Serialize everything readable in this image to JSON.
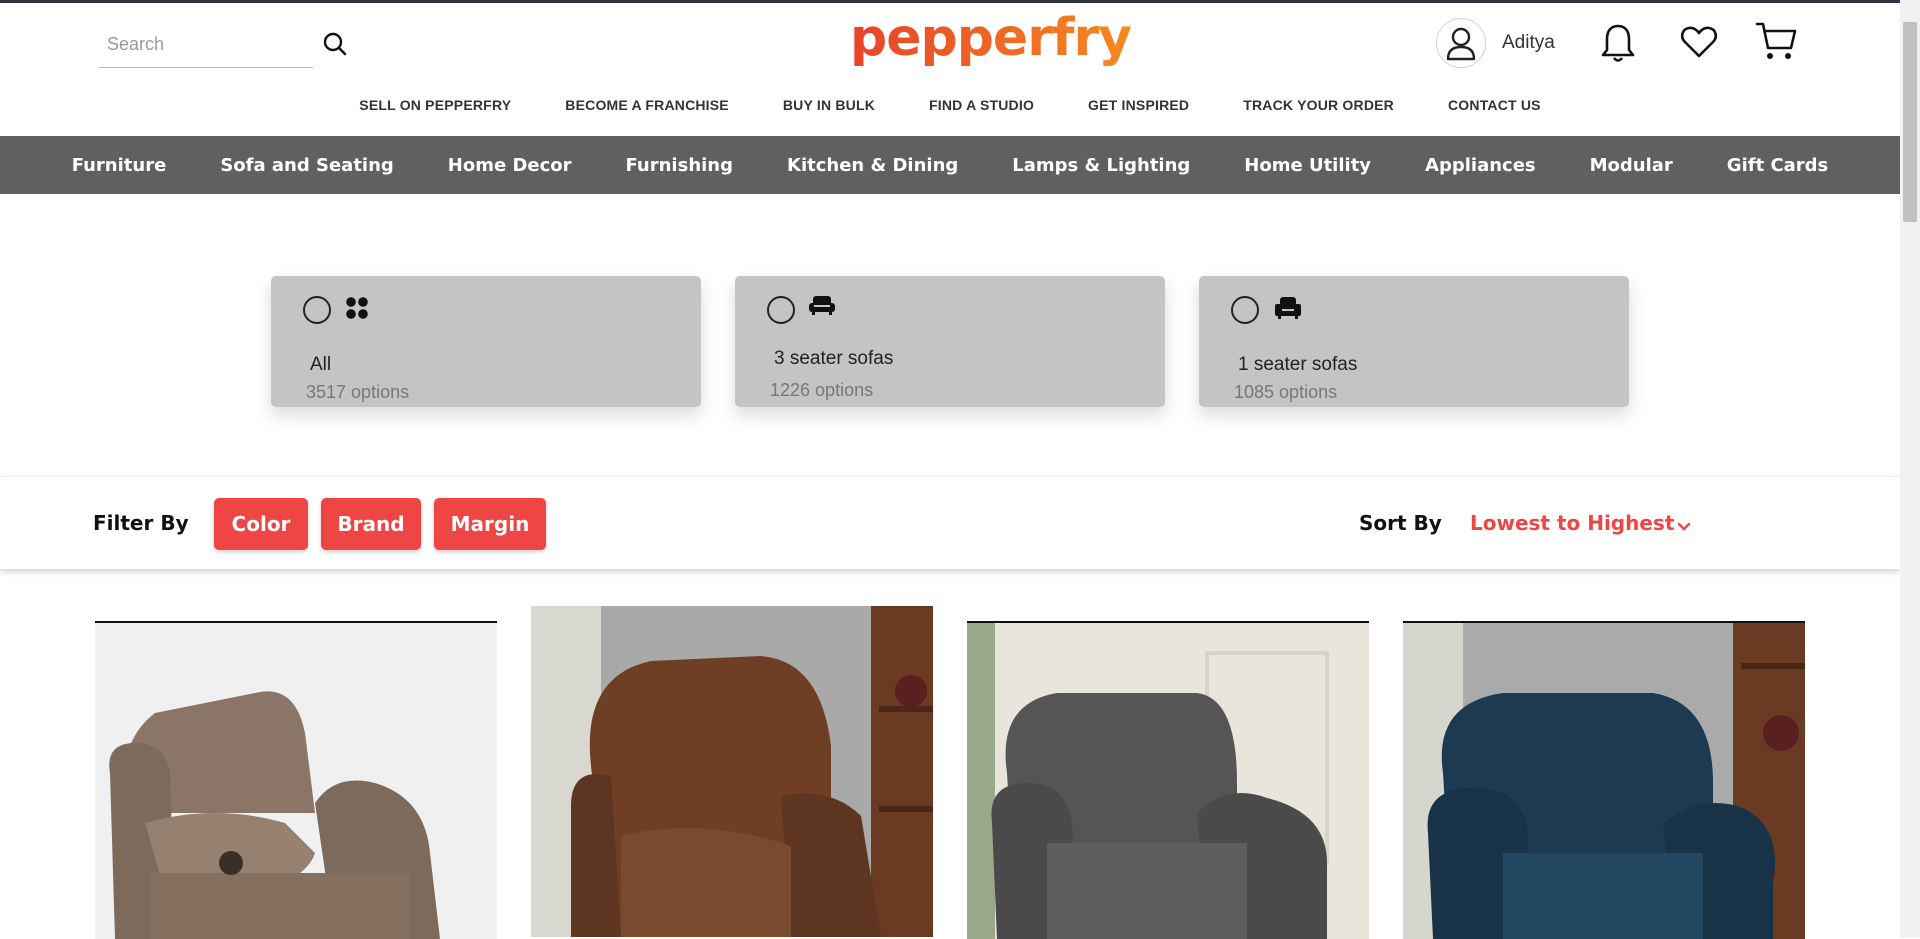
{
  "header": {
    "search_placeholder": "Search",
    "logo_text": "pepperfry",
    "username": "Aditya"
  },
  "util_links": [
    "SELL ON PEPPERFRY",
    "BECOME A FRANCHISE",
    "BUY IN BULK",
    "FIND A STUDIO",
    "GET INSPIRED",
    "TRACK YOUR ORDER",
    "CONTACT US"
  ],
  "categories": [
    "Furniture",
    "Sofa and Seating",
    "Home Decor",
    "Furnishing",
    "Kitchen & Dining",
    "Lamps & Lighting",
    "Home Utility",
    "Appliances",
    "Modular",
    "Gift Cards"
  ],
  "option_cards": [
    {
      "title": "All",
      "count": "3517 options",
      "icon": "grid-icon"
    },
    {
      "title": "3 seater sofas",
      "count": "1226 options",
      "icon": "sofa-icon"
    },
    {
      "title": "1 seater sofas",
      "count": "1085 options",
      "icon": "armchair-icon"
    }
  ],
  "filter": {
    "label": "Filter By",
    "chips": [
      "Color",
      "Brand",
      "Margin"
    ],
    "sort_label": "Sort By",
    "sort_value": "Lowest to Highest"
  },
  "colors": {
    "brand_gradient_start": "#e8422a",
    "brand_gradient_end": "#f58a1f",
    "accent_red": "#f04545",
    "nav_bg": "#606060",
    "card_bg": "#c4c4c4"
  },
  "products": [
    {
      "name": "recliner-brown-suede",
      "color": "#8a7566"
    },
    {
      "name": "recliner-brown-leather",
      "color": "#6e3f24"
    },
    {
      "name": "recliner-grey-fabric",
      "color": "#555555"
    },
    {
      "name": "recliner-teal-fabric",
      "color": "#1c3b52"
    }
  ]
}
